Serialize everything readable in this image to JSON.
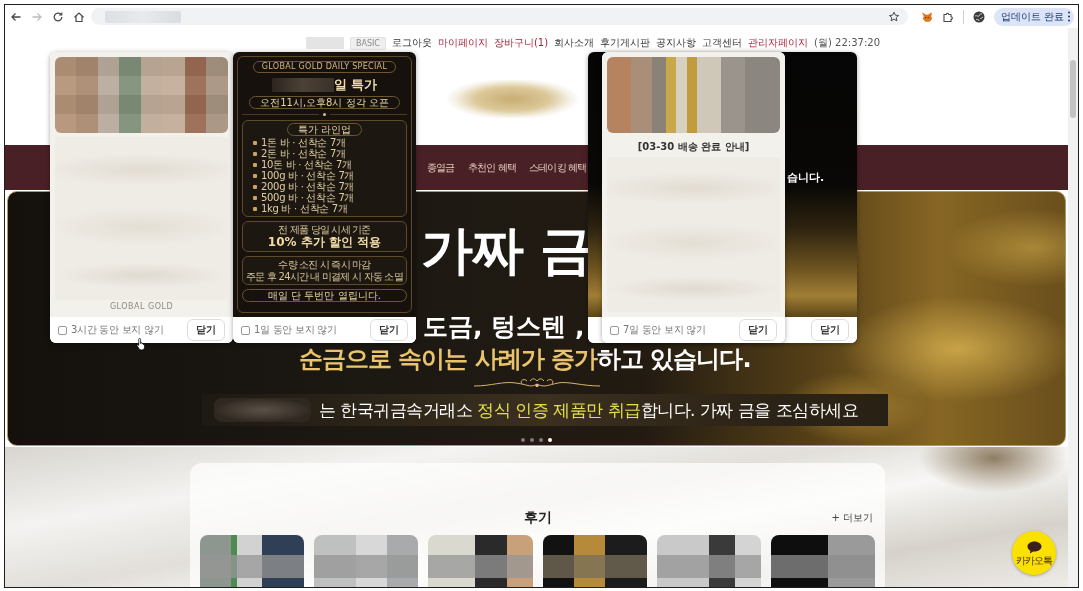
{
  "browser": {
    "nav_buttons": [
      {
        "kind": "back",
        "disabled": false
      },
      {
        "kind": "forward",
        "disabled": true
      },
      {
        "kind": "reload",
        "disabled": false
      },
      {
        "kind": "home",
        "disabled": false
      }
    ],
    "update_button": "업데이트 완료"
  },
  "header": {
    "tier_badge": "BASIC",
    "links": [
      {
        "label": "로그아웃",
        "accent": false
      },
      {
        "label": "마이페이지",
        "accent": true
      },
      {
        "label": "장바구니(1)",
        "accent": true
      },
      {
        "label": "회사소개",
        "accent": false
      },
      {
        "label": "후기게시판",
        "accent": false
      },
      {
        "label": "공지사항",
        "accent": false
      },
      {
        "label": "고객센터",
        "accent": false
      },
      {
        "label": "관리자페이지",
        "accent": true
      }
    ],
    "datetime": "(월) 22:37:20"
  },
  "main_nav": {
    "items": [
      "종열금",
      "추천인 혜택",
      "스테이킹 혜택"
    ]
  },
  "banner": {
    "headline": "가짜 금",
    "subline": "도금, 텅스텐 ,",
    "warning": [
      {
        "text": "순금으로 속이는 사례가 증가",
        "highlight": true
      },
      {
        "text": "하고 있습니다.",
        "highlight": false
      }
    ],
    "notice": [
      {
        "text": "는 한국귀금속거래소 ",
        "highlight": false
      },
      {
        "text": "정식 인증 제품만 취급",
        "highlight": true
      },
      {
        "text": "합니다. 가짜 금을 조심하세요",
        "highlight": false
      }
    ],
    "slides": [
      {
        "selected": false
      },
      {
        "selected": false
      },
      {
        "selected": false
      },
      {
        "selected": true
      }
    ]
  },
  "popups": [
    {
      "kind": "photo",
      "caption": "GLOBAL GOLD",
      "dont_show": {
        "label": "3시간 동안 보지 않기",
        "checked": false
      },
      "close_label": "닫기"
    },
    {
      "kind": "daily_special",
      "badge": "GLOBAL GOLD DAILY SPECIAL",
      "title": "일 특가",
      "hours": "오전11시,오후8시 정각 오픈",
      "lineup": {
        "title": "특가 라인업",
        "items": [
          "1돈 바 · 선착순 7개",
          "2돈 바 · 선착순 7개",
          "10돈 바 · 선착순 7개",
          "100g 바 · 선착순 7개",
          "200g 바 · 선착순 7개",
          "500g 바 · 선착순 7개",
          "1kg 바 · 선착순 7개"
        ]
      },
      "discount": {
        "note": "전 제품 당일 시세 기준",
        "headline": "10% 추가 할인 적용"
      },
      "rules": [
        "수량 소진 시 즉시 마감",
        "주문 후 24시간 내 미결제 시 자동 소멸"
      ],
      "footer_note": "매일 단 두번만 열립니다.",
      "dont_show": {
        "label": "1일 동안 보지 않기",
        "checked": false
      },
      "close_label": "닫기"
    },
    {
      "kind": "notice",
      "title": "[03-30 배송 완료 안내]",
      "dont_show": {
        "label": "7일 동안 보지 않기",
        "checked": false
      },
      "close_label": "닫기"
    },
    {
      "kind": "image",
      "text": "습니다.",
      "close_label": "닫기"
    }
  ],
  "reviews": {
    "title": "후기",
    "more_link": "+ 더보기"
  },
  "chat_button": {
    "label": "카카오톡"
  }
}
